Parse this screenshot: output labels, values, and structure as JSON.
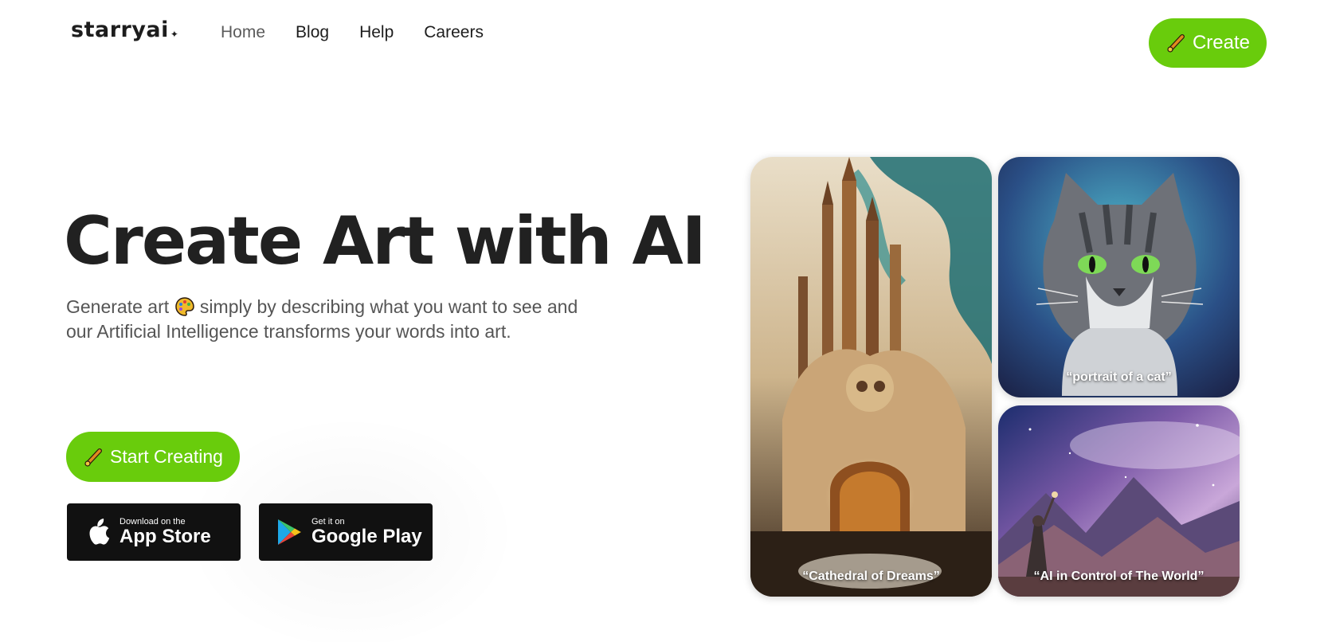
{
  "brand": {
    "name": "starryai",
    "star_glyph": "✦"
  },
  "nav": {
    "items": [
      "Home",
      "Blog",
      "Help",
      "Careers"
    ],
    "active": "Home"
  },
  "header": {
    "create_label": "Create"
  },
  "hero": {
    "title": "Create Art with AI",
    "subtitle_part1": "Generate art",
    "subtitle_part2": "simply by describing what you want to see and our Artificial Intelligence transforms your words into art."
  },
  "cta": {
    "start_label": "Start Creating"
  },
  "stores": {
    "app_store": {
      "small": "Download on the",
      "big": "App Store"
    },
    "google_play": {
      "small": "Get it on",
      "big": "Google Play"
    }
  },
  "gallery": [
    {
      "caption": "“Cathedral of Dreams”"
    },
    {
      "caption": "“portrait of a cat”"
    },
    {
      "caption": "“AI in Control of The World”"
    }
  ],
  "colors": {
    "accent": "#69cc0c",
    "store_bg": "#111111",
    "title": "#212121"
  },
  "icons": {
    "brush": "paintbrush-icon",
    "palette": "palette-icon",
    "apple": "apple-icon",
    "play": "google-play-icon"
  }
}
